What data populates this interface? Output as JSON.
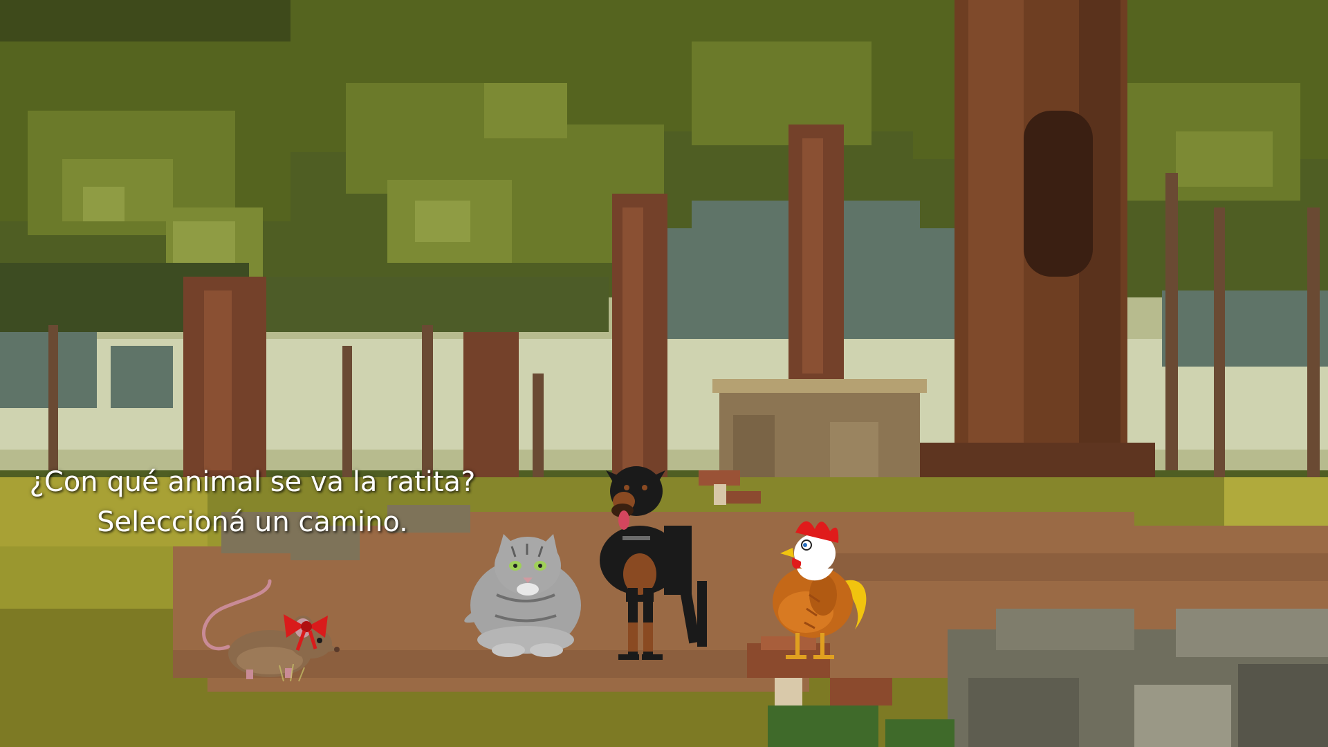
{
  "game": {
    "prompt_question": "¿Con qué animal se va la ratita?",
    "prompt_instruction": "Seleccioná un camino."
  },
  "characters": {
    "player": "ratita",
    "choices": [
      "gato",
      "perro",
      "gallo"
    ]
  },
  "colors": {
    "prompt_text": "#ffffff",
    "path": "#9a6a45",
    "grass": "#8a8a2a",
    "foliage": "#5a6a25",
    "tree_trunk": "#6e3e22",
    "sky": "#cfd3b0",
    "bow": "#d91b1b"
  }
}
